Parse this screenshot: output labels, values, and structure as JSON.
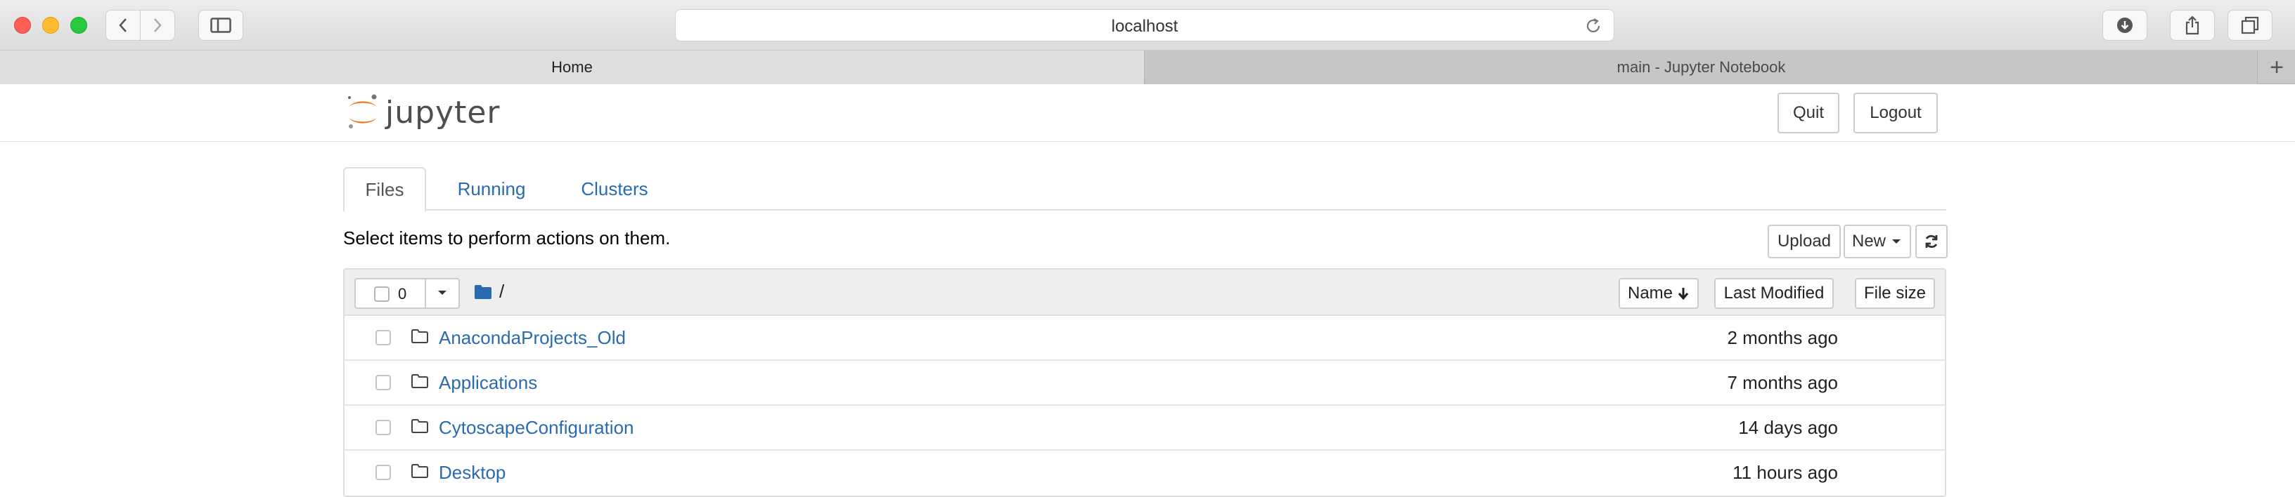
{
  "browser": {
    "address": "localhost",
    "tabs": [
      {
        "label": "Home",
        "active": true
      },
      {
        "label": "main - Jupyter Notebook",
        "active": false
      }
    ],
    "new_tab_label": "+"
  },
  "header": {
    "logo_text": "jupyter",
    "quit_label": "Quit",
    "logout_label": "Logout"
  },
  "notebook_tabs": [
    {
      "label": "Files",
      "active": true
    },
    {
      "label": "Running",
      "active": false
    },
    {
      "label": "Clusters",
      "active": false
    }
  ],
  "toolbar": {
    "hint": "Select items to perform actions on them.",
    "upload_label": "Upload",
    "new_label": "New",
    "refresh_icon": "refresh-icon"
  },
  "file_list": {
    "selected_count": "0",
    "path": "/",
    "columns": {
      "name": "Name",
      "last_modified": "Last Modified",
      "file_size": "File size"
    },
    "items": [
      {
        "name": "AnacondaProjects_Old",
        "modified": "2 months ago",
        "type": "folder"
      },
      {
        "name": "Applications",
        "modified": "7 months ago",
        "type": "folder"
      },
      {
        "name": "CytoscapeConfiguration",
        "modified": "14 days ago",
        "type": "folder"
      },
      {
        "name": "Desktop",
        "modified": "11 hours ago",
        "type": "folder"
      }
    ]
  },
  "colors": {
    "link": "#2a6ab0",
    "logo_orange": "#f37726",
    "folder_blue": "#2a6ab0"
  }
}
